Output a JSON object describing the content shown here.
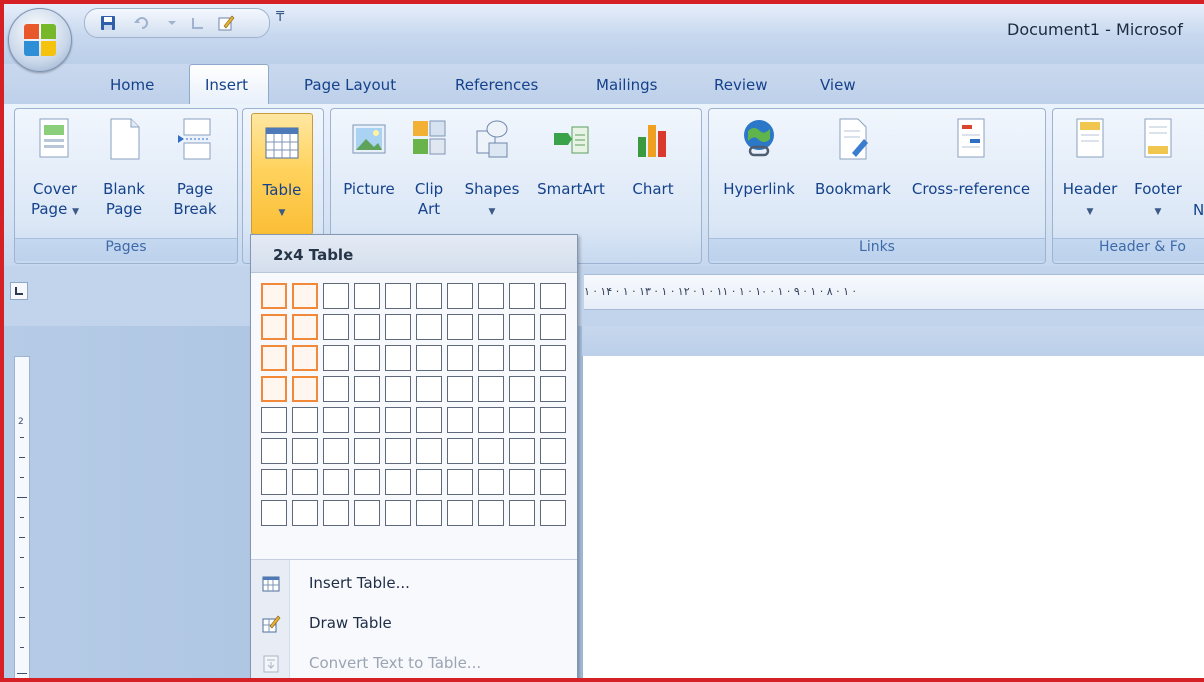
{
  "window": {
    "title": "Document1 - Microsof"
  },
  "tabs": [
    {
      "label": "Home"
    },
    {
      "label": "Insert"
    },
    {
      "label": "Page Layout"
    },
    {
      "label": "References"
    },
    {
      "label": "Mailings"
    },
    {
      "label": "Review"
    },
    {
      "label": "View"
    }
  ],
  "ribbon": {
    "pages": {
      "label": "Pages",
      "cover_line1": "Cover",
      "cover_line2": "Page",
      "blank_line1": "Blank",
      "blank_line2": "Page",
      "break_line1": "Page",
      "break_line2": "Break"
    },
    "tables": {
      "table_label": "Table"
    },
    "illustrations": {
      "picture": "Picture",
      "clip_line1": "Clip",
      "clip_line2": "Art",
      "shapes": "Shapes",
      "smartart": "SmartArt",
      "chart": "Chart"
    },
    "links": {
      "label": "Links",
      "hyperlink": "Hyperlink",
      "bookmark": "Bookmark",
      "crossref": "Cross-reference"
    },
    "header_footer": {
      "label": "Header & Fo",
      "header": "Header",
      "footer": "Footer",
      "page_number_partial": "N"
    }
  },
  "ruler": {
    "text": "۱ · ۱۴ · ۱ · ۱۳ · ۱ · ۱۲ · ۱ · ۱۱ · ۱ · ۱۰ · ۱ · ۹ · ۱ · ۸ · ۱ ·"
  },
  "vertical_ruler": {
    "mark": "2"
  },
  "table_dropdown": {
    "header": "2x4 Table",
    "grid": {
      "cols": 10,
      "rows": 8,
      "selected_cols": 2,
      "selected_rows": 4
    },
    "items": [
      {
        "label": "Insert Table...",
        "enabled": true
      },
      {
        "label": "Draw Table",
        "enabled": true
      },
      {
        "label": "Convert Text to Table...",
        "enabled": false
      }
    ]
  },
  "colors": {
    "frame_border": "#d52026",
    "tab_text": "#15428b",
    "grid_selected": "#f2883a",
    "table_button": "#ffd35e"
  }
}
